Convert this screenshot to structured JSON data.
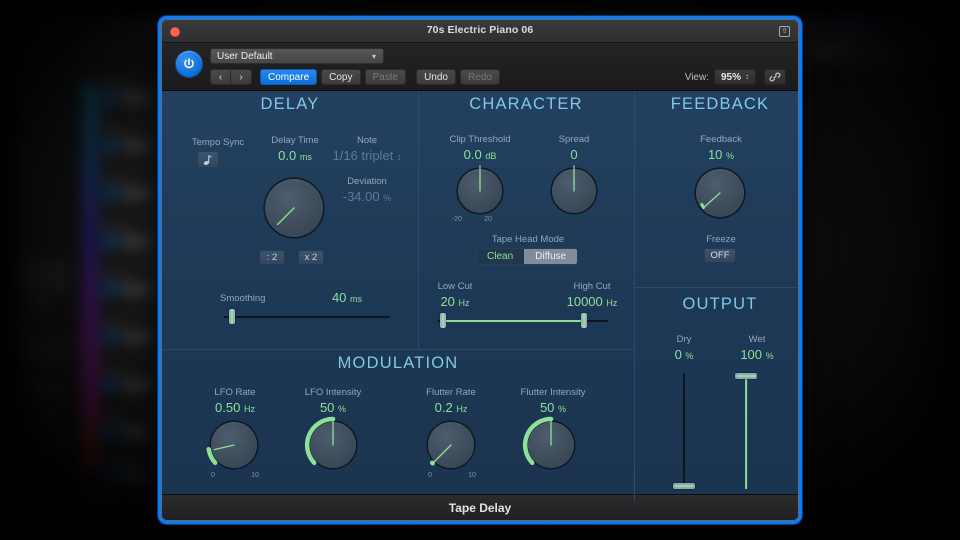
{
  "window": {
    "title": "70s Electric Piano 06",
    "close_icon": "close-dot",
    "expand_icon": "expand-icon",
    "footer_title": "Tape Delay"
  },
  "toolbar": {
    "power_icon": "power-icon",
    "preset_name": "User Default",
    "preset_chevron": "chevron-down-icon",
    "prev_label": "‹",
    "next_label": "›",
    "compare_label": "Compare",
    "copy_label": "Copy",
    "paste_label": "Paste",
    "undo_label": "Undo",
    "redo_label": "Redo",
    "view_label": "View:",
    "view_value": "95%",
    "view_stepper_icon": "stepper-arrows-icon",
    "link_icon": "link-icon"
  },
  "sections": {
    "delay": {
      "title": "DELAY",
      "tempo_sync": {
        "label": "Tempo Sync",
        "icon": "note-icon"
      },
      "delay_time": {
        "label": "Delay Time",
        "value": "0.0",
        "unit": "ms"
      },
      "note": {
        "label": "Note",
        "value": "1/16 triplet",
        "chevron": "stepper-arrows-icon"
      },
      "deviation": {
        "label": "Deviation",
        "value": "-34.00",
        "unit": "%"
      },
      "knob": {
        "name": "delay-time-knob",
        "angle_deg": 215
      },
      "div2_label": ": 2",
      "mul2_label": "x 2",
      "smoothing": {
        "label": "Smoothing",
        "value": "40",
        "unit": "ms",
        "pct": 4
      }
    },
    "character": {
      "title": "CHARACTER",
      "clip_threshold": {
        "label": "Clip Threshold",
        "value": "0.0",
        "unit": "dB",
        "angle_deg": 0,
        "tick_min": "-20",
        "tick_max": "20"
      },
      "spread": {
        "label": "Spread",
        "value": "0",
        "unit": "",
        "angle_deg": 0
      },
      "tape_head_mode": {
        "label": "Tape Head Mode",
        "options": [
          "Clean",
          "Diffuse"
        ],
        "selected": "Clean"
      },
      "low_cut": {
        "label": "Low Cut",
        "value": "20",
        "unit": "Hz",
        "pct": 5
      },
      "high_cut": {
        "label": "High Cut",
        "value": "10000",
        "unit": "Hz",
        "pct": 88
      }
    },
    "feedback": {
      "title": "FEEDBACK",
      "feedback": {
        "label": "Feedback",
        "value": "10",
        "unit": "%",
        "angle_deg": 222
      },
      "freeze": {
        "label": "Freeze",
        "value": "OFF"
      }
    },
    "output": {
      "title": "OUTPUT",
      "dry": {
        "label": "Dry",
        "value": "0",
        "unit": "%",
        "pct": 0
      },
      "wet": {
        "label": "Wet",
        "value": "100",
        "unit": "%",
        "pct": 100
      }
    },
    "modulation": {
      "title": "MODULATION",
      "lfo_rate": {
        "label": "LFO Rate",
        "value": "0.50",
        "unit": "Hz",
        "angle_deg": 256,
        "arc_pct": 17,
        "tick_min": "0",
        "tick_max": "10"
      },
      "lfo_intensity": {
        "label": "LFO Intensity",
        "value": "50",
        "unit": "%",
        "angle_deg": 0,
        "arc_pct": 50
      },
      "flutter_rate": {
        "label": "Flutter Rate",
        "value": "0.2",
        "unit": "Hz",
        "angle_deg": 215,
        "arc_pct": 2,
        "tick_min": "0",
        "tick_max": "10"
      },
      "flutter_intensity": {
        "label": "Flutter Intensity",
        "value": "50",
        "unit": "%",
        "angle_deg": 0,
        "arc_pct": 50
      }
    }
  },
  "colors": {
    "accent_green": "#8de09a",
    "section_title": "#7fc8e8",
    "panel_bg": "#1e3a57",
    "window_border": "#0a7bff",
    "label": "#93a7bd"
  }
}
